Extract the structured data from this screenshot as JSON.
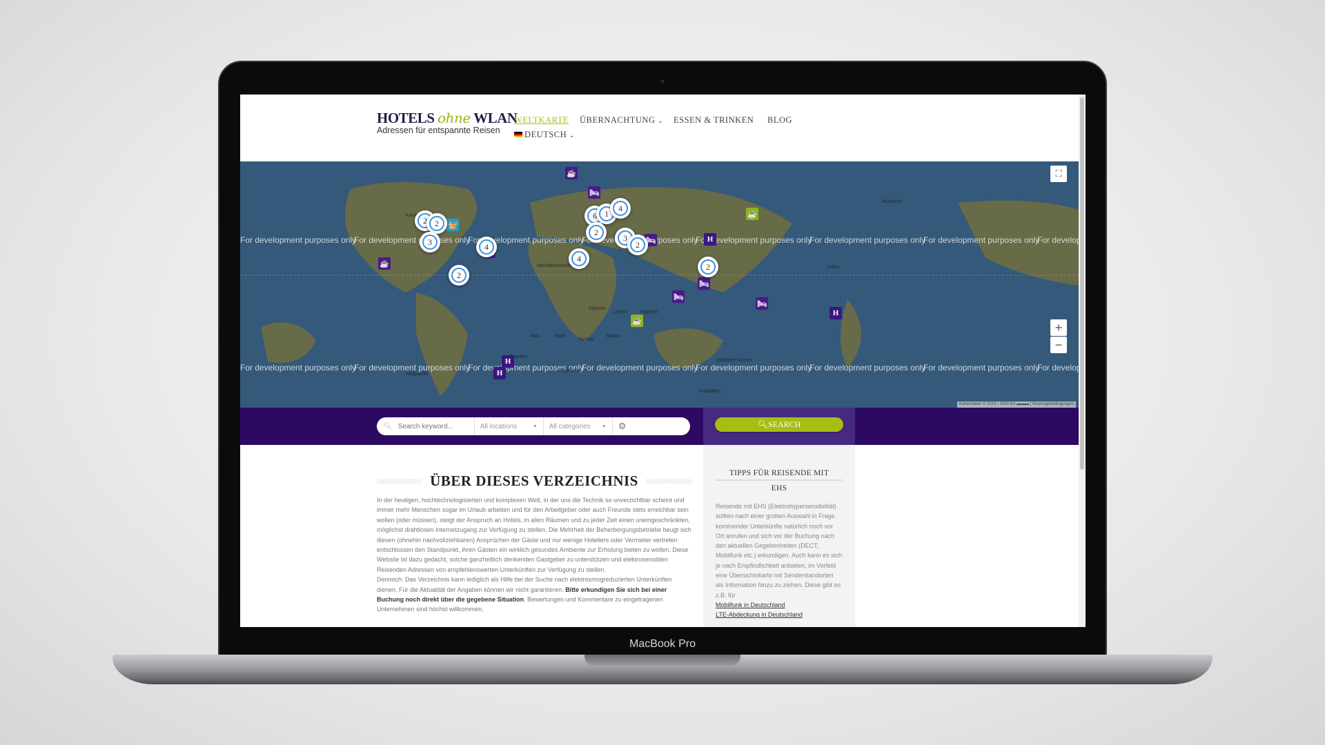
{
  "device": {
    "label": "MacBook Pro"
  },
  "header": {
    "logo": {
      "part1": "HOTELS",
      "part2": "ohne",
      "part3": "WLAN",
      "tagline": "Adressen für entspannte Reisen"
    },
    "nav": [
      {
        "label": "WELTKARTE",
        "active": true
      },
      {
        "label": "ÜBERNACHTUNG",
        "dropdown": true
      },
      {
        "label": "ESSEN & TRINKEN"
      },
      {
        "label": "BLOG"
      }
    ],
    "language": {
      "label": "DEUTSCH",
      "flag": "de-flag"
    }
  },
  "map": {
    "watermark": "For development purposes only",
    "clusters": [
      "2",
      "2",
      "3",
      "2",
      "4",
      "6",
      "1",
      "4",
      "2",
      "3",
      "2",
      "4",
      "2"
    ],
    "markers": [
      "bed",
      "bed",
      "bed",
      "bed",
      "bed",
      "bed",
      "hotel-h",
      "hotel-h",
      "hotel-h",
      "hotel-h",
      "restaurant-green",
      "restaurant-green",
      "shop-basket",
      "cafe-purple",
      "cafe-purple"
    ],
    "labels": [
      "Kanada",
      "Nordatlantischer Ozean",
      "Algerien",
      "Libyen",
      "Ägypten",
      "Mali",
      "Niger",
      "Tschad",
      "Sudan",
      "Brasilien",
      "Südpazifik",
      "Südatlantik",
      "Indischer Ozean",
      "Australien",
      "Russland",
      "Indien"
    ],
    "attribution": {
      "data": "Kartendaten © 2019",
      "scale": "1000 km",
      "terms": "Nutzungsbedingungen"
    },
    "fullscreen_icon": "fullscreen-icon",
    "zoom_in": "+",
    "zoom_out": "−"
  },
  "colors": {
    "brand_purple": "#2c0a62",
    "accent_green": "#a6bd12",
    "logo_navy": "#1f1f4a"
  },
  "search": {
    "keyword_placeholder": "Search keyword...",
    "location": "All locations",
    "category": "All categories",
    "button": "SEARCH"
  },
  "main": {
    "title": "ÜBER DIESES VERZEICHNIS",
    "p1": "In der heutigen, hochtechnologisierten und komplexen Welt, in der uns die Technik so unverzichtbar scheint und immer mehr Menschen sogar im Urlaub arbeiten und für den Arbeitgeber oder auch Freunde stets erreichbar sein wollen (oder müssen), steigt der Anspruch an Hotels, in allen Räumen und zu jeder Zeit einen uneingeschränkten, möglichst drahtlosen Internetzugang zur Verfügung zu stellen. Die Mehrheit der Beherbergungsbetriebe beugt sich diesen (ohnehin nachvollziehbaren) Ansprüchen der Gäste und nur wenige Hoteliers oder Vermieter vertreten entschlossen den Standpunkt, ihren Gästen ein wirklich gesundes Ambiente zur Erholung bieten zu wollen. Diese Website ist dazu gedacht, solche ganzheitlich denkenden Gastgeber zu unterstützen und elektrosensiblen Reisenden Adressen von empfehlenswerten Unterkünften zur Verfügung zu stellen.",
    "p2a": "Dennoch: Das Verzeichnis kann lediglich als Hilfe bei der Suche nach elektrosmogreduzierten Unterkünften dienen. Für die Aktualität der Angaben können wir nicht garantieren. ",
    "p2b": "Bitte erkundigen Sie sich bei einer Buchung noch direkt über die gegebene Situation",
    "p2c": ". Bewertungen und Kommentare zu eingetragenen Unternehmen sind höchst willkommen."
  },
  "sidebar": {
    "title1": "TIPPS FÜR REISENDE MIT",
    "title2": "EHS",
    "text": "Reisende mit EHS (Elektrohypersensibilität) sollten nach einer groben Auswahl in Frage kommender Unterkünfte natürlich noch vor Ort anrufen und sich vor der Buchung nach den aktuellen Gegebenheiten (DECT, Mobilfunk etc.) erkundigen. Auch kann es sich je nach Empfindlichkeit anbieten, im Vorfeld eine Übersichtskarte mit Senderstandorten als Information hinzu zu ziehen. Diese gibt es z.B. für",
    "links": [
      "Mobilfunk in Deutschland",
      "LTE-Abdeckung in Deutschland"
    ]
  }
}
